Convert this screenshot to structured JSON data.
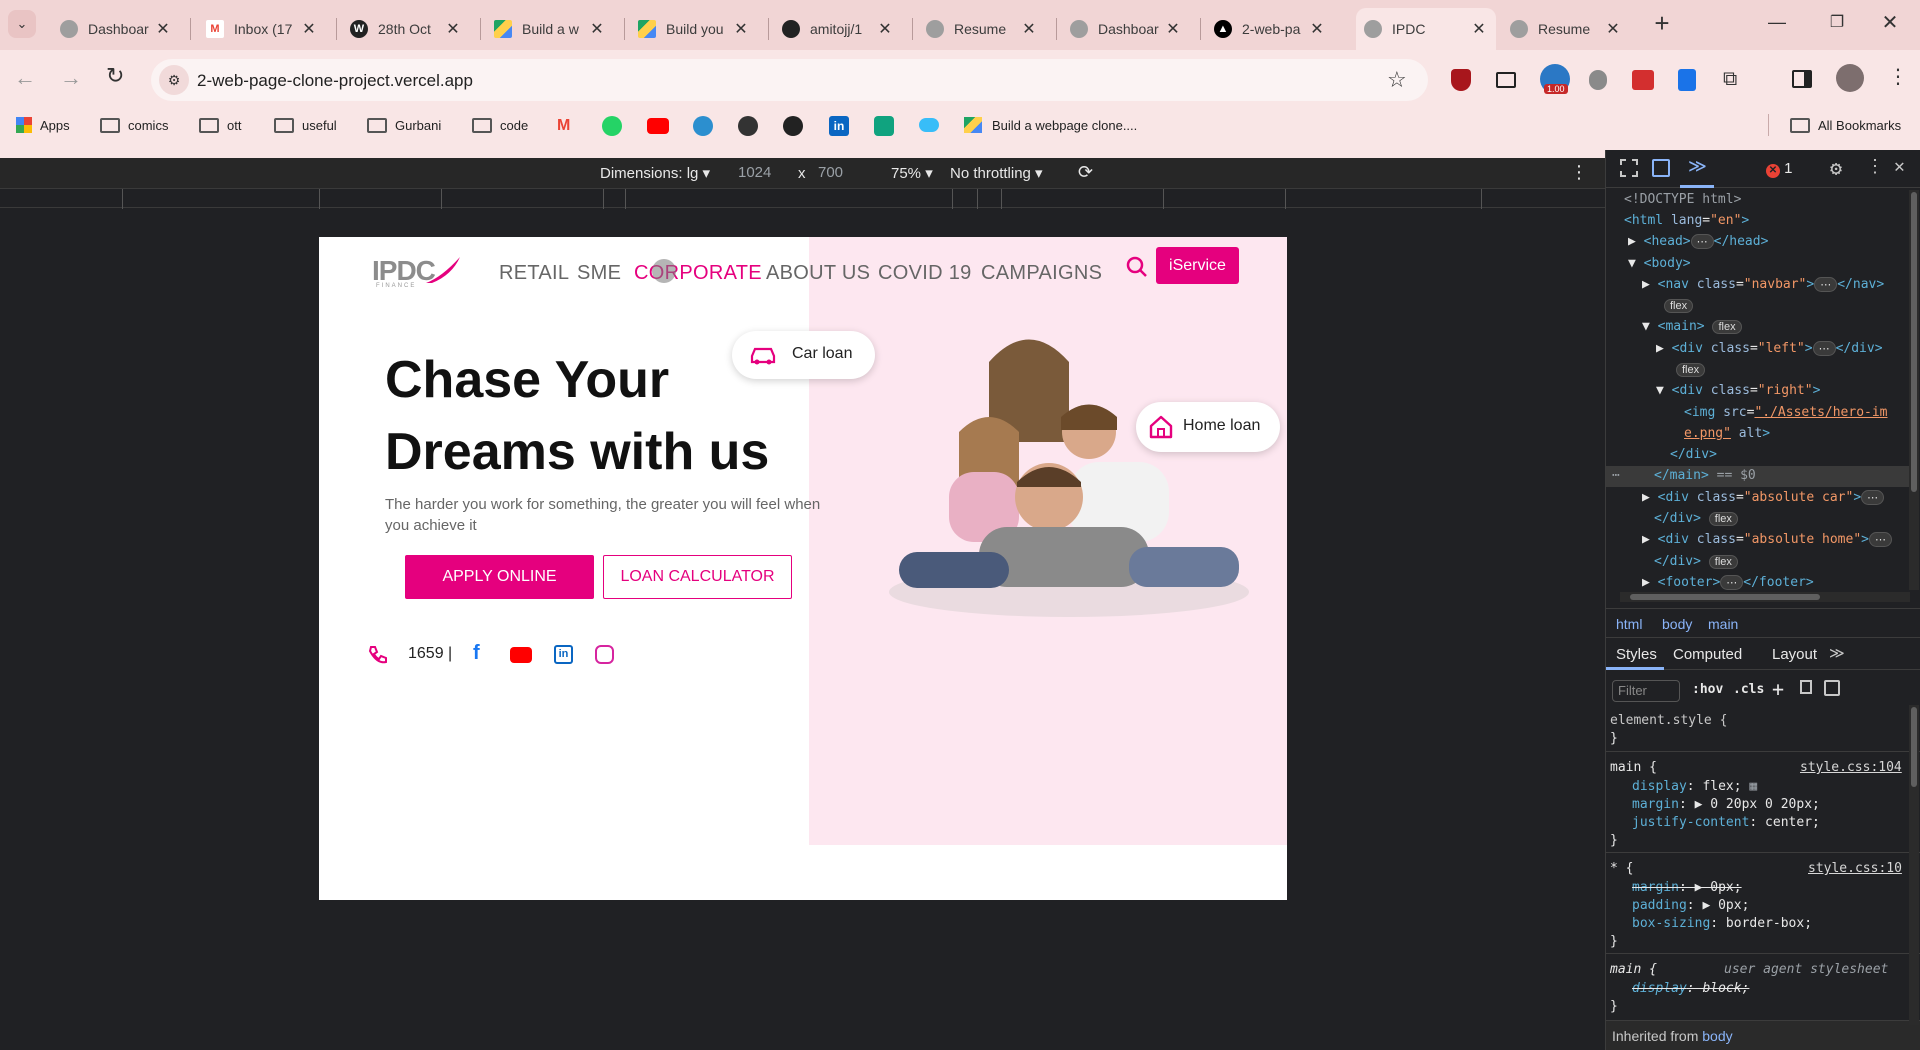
{
  "tabs": [
    {
      "title": "Dashboar",
      "fav": "#9e9e9e",
      "icon": "globe-icon"
    },
    {
      "title": "Inbox (17",
      "fav": "#ea4335",
      "icon": "gmail-icon"
    },
    {
      "title": "28th Oct",
      "fav": "#222222",
      "icon": "wordpress-icon"
    },
    {
      "title": "Build a w",
      "fav": "#1fa463",
      "icon": "drive-icon"
    },
    {
      "title": "Build you",
      "fav": "#1fa463",
      "icon": "drive-icon"
    },
    {
      "title": "amitojj/1",
      "fav": "#222222",
      "icon": "github-icon"
    },
    {
      "title": "Resume",
      "fav": "#9e9e9e",
      "icon": "globe-icon"
    },
    {
      "title": "Dashboar",
      "fav": "#9e9e9e",
      "icon": "globe-icon"
    },
    {
      "title": "2-web-pa",
      "fav": "#000000",
      "icon": "vercel-icon"
    },
    {
      "title": "IPDC",
      "fav": "#9e9e9e",
      "icon": "globe-icon"
    },
    {
      "title": "Resume",
      "fav": "#9e9e9e",
      "icon": "globe-icon"
    }
  ],
  "url": "2-web-page-clone-project.vercel.app",
  "extension_badge": "1.00",
  "bookmarks": {
    "apps": "Apps",
    "folders": [
      "comics",
      "ott",
      "useful",
      "Gurbani",
      "code"
    ],
    "last": "Build a webpage clone....",
    "all": "All Bookmarks"
  },
  "devbar": {
    "dimensions": "Dimensions: lg",
    "width": "1024",
    "x": "x",
    "height": "700",
    "zoom": "75%",
    "throttle": "No throttling"
  },
  "site": {
    "logo": "IPDC",
    "logo_sub": "FINANCE",
    "nav": [
      "RETAIL",
      "SME",
      "CORPORATE",
      "ABOUT US",
      "COVID 19",
      "CAMPAIGNS"
    ],
    "iservice": "iService",
    "hero_line1": "Chase Your",
    "hero_line2": "Dreams with us",
    "hero_sub": "The harder you work for something, the greater you will feel when you achieve it",
    "apply": "APPLY ONLINE",
    "calc": "LOAN CALCULATOR",
    "phone": "1659 |",
    "car_loan": "Car loan",
    "home_loan": "Home loan",
    "accent": "#e5007e"
  },
  "devtools": {
    "error_count": "1",
    "crumbs": [
      "html",
      "body",
      "main"
    ],
    "tabs": [
      "Styles",
      "Computed",
      "Layout"
    ],
    "filter": "Filter",
    "hov": ":hov",
    "cls": ".cls",
    "inherited": "Inherited from",
    "inherited_el": "body"
  }
}
